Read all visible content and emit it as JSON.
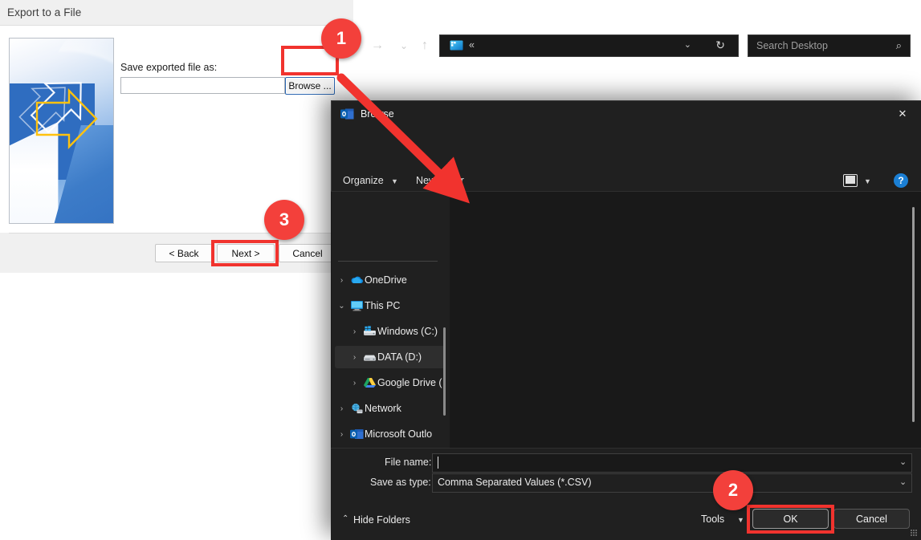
{
  "wizard": {
    "title": "Export to a File",
    "field_label": "Save exported file as:",
    "field_value": "",
    "browse_label": "Browse ...",
    "buttons": {
      "back": "< Back",
      "next": "Next >",
      "cancel": "Cancel"
    }
  },
  "dialog": {
    "title": "Browse",
    "app_icon": "outlook-icon",
    "close_icon": "✕",
    "nav": {
      "back_icon": "←",
      "forward_icon": "→",
      "recent_icon": "⌄",
      "up_icon": "↑"
    },
    "address": {
      "icon": "desktop-icon",
      "crumb": "«",
      "chevron": "⌄",
      "refresh": "↻"
    },
    "search": {
      "placeholder": "Search Desktop",
      "icon": "⌕"
    },
    "toolbar": {
      "organize": "Organize",
      "organize_caret": "▼",
      "new_folder": "New folder",
      "view_caret": "▼",
      "help": "?"
    },
    "sidebar": [
      {
        "label": "OneDrive",
        "twisty": "›",
        "icon": "onedrive-cloud-icon",
        "selected": false,
        "indent": 0
      },
      {
        "label": "This PC",
        "twisty": "⌄",
        "icon": "this-pc-monitor-icon",
        "selected": false,
        "indent": 0
      },
      {
        "label": "Windows (C:)",
        "twisty": "›",
        "icon": "windows-drive-icon",
        "selected": false,
        "indent": 1
      },
      {
        "label": "DATA (D:)",
        "twisty": "›",
        "icon": "hard-drive-icon",
        "selected": true,
        "indent": 1
      },
      {
        "label": "Google Drive (",
        "twisty": "›",
        "icon": "google-drive-icon",
        "selected": false,
        "indent": 1
      },
      {
        "label": "Network",
        "twisty": "›",
        "icon": "network-icon",
        "selected": false,
        "indent": 0
      },
      {
        "label": "Microsoft Outlo",
        "twisty": "›",
        "icon": "outlook-icon",
        "selected": false,
        "indent": 0
      }
    ],
    "file_list_items": [],
    "filename": {
      "label": "File name:",
      "value": "",
      "chevron": "⌄"
    },
    "savetype": {
      "label": "Save as type:",
      "value": "Comma Separated Values (*.CSV)",
      "chevron": "⌄"
    },
    "hide_folders": {
      "caret": "⌃",
      "label": "Hide Folders"
    },
    "tools": {
      "label": "Tools",
      "caret": "▼"
    },
    "buttons": {
      "ok": "OK",
      "cancel": "Cancel"
    }
  },
  "annotations": {
    "badges": [
      "1",
      "2",
      "3"
    ],
    "accent_color": "#f3403b",
    "highlight_color": "#f1332e"
  }
}
